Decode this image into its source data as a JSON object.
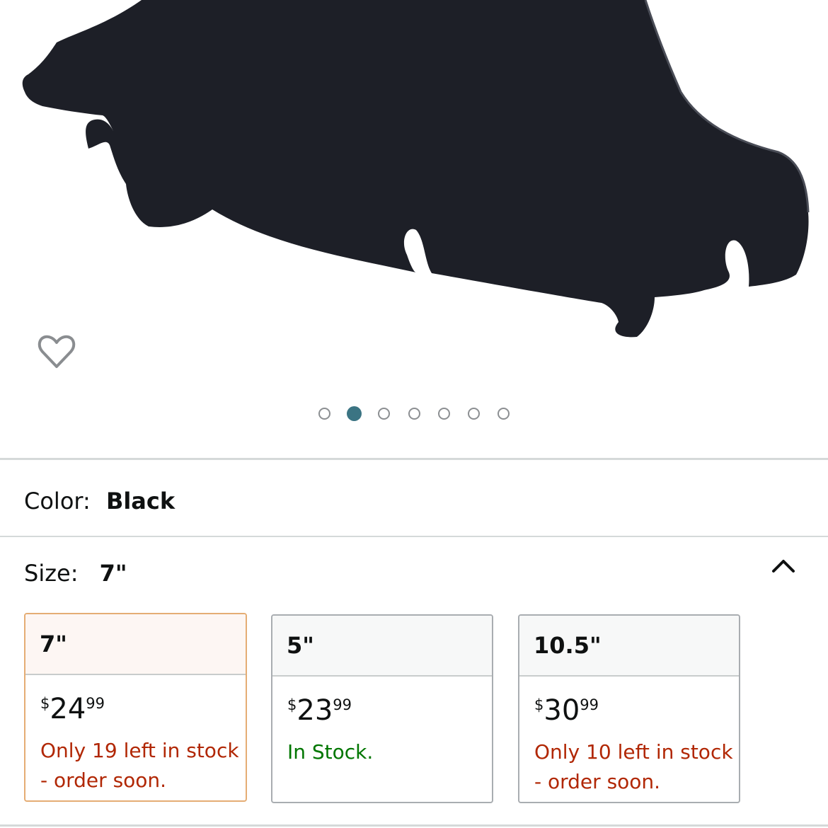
{
  "gallery": {
    "image_alt": "Black motorcycle windshield",
    "wishlist_icon": "heart-outline-icon",
    "dots_count": 7,
    "active_dot_index": 1,
    "dot_active_color": "#3b7483"
  },
  "color": {
    "label": "Color:",
    "value": "Black"
  },
  "size": {
    "label": "Size:",
    "value": "7\"",
    "collapse_icon": "chevron-up-icon",
    "options": [
      {
        "label": "7\"",
        "currency": "$",
        "price_whole": "24",
        "price_fraction": "99",
        "stock_line1": "Only 19 left in stock",
        "stock_line2": "- order soon.",
        "stock_status": "low",
        "selected": true
      },
      {
        "label": "5\"",
        "currency": "$",
        "price_whole": "23",
        "price_fraction": "99",
        "stock_line1": "In Stock.",
        "stock_line2": "",
        "stock_status": "ok",
        "selected": false
      },
      {
        "label": "10.5\"",
        "currency": "$",
        "price_whole": "30",
        "price_fraction": "99",
        "stock_line1": "Only 10 left in stock",
        "stock_line2": "- order soon.",
        "stock_status": "low",
        "selected": false
      }
    ]
  },
  "colors": {
    "low_stock": "#b12704",
    "in_stock": "#007600",
    "selected_border": "#e5ad74"
  }
}
